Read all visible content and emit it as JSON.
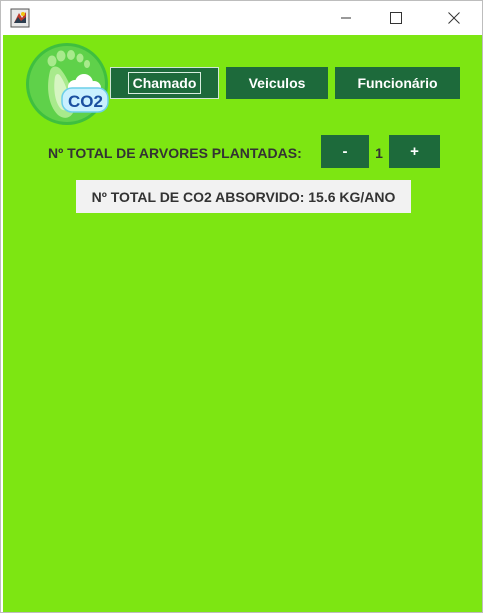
{
  "window": {
    "icons": {
      "app": "java-app-icon",
      "minimize": "minimize-icon",
      "maximize": "maximize-icon",
      "close": "close-icon"
    }
  },
  "logo": {
    "text": "CO2",
    "icon": "footprint-co2-logo"
  },
  "nav": {
    "chamado_label": "Chamado",
    "veiculos_label": "Veiculos",
    "funcionario_label": "Funcionário"
  },
  "trees": {
    "label": "Nº TOTAL DE ARVORES PLANTADAS:",
    "minus_label": "-",
    "count": "1",
    "plus_label": "+"
  },
  "co2": {
    "text": "Nº TOTAL DE CO2 ABSORVIDO: 15.6 KG/ANO"
  },
  "colors": {
    "background": "#7de612",
    "button": "#1d6a3b",
    "button_text": "#ffffff",
    "label_text": "#333333",
    "info_box": "#f2f2f2"
  }
}
